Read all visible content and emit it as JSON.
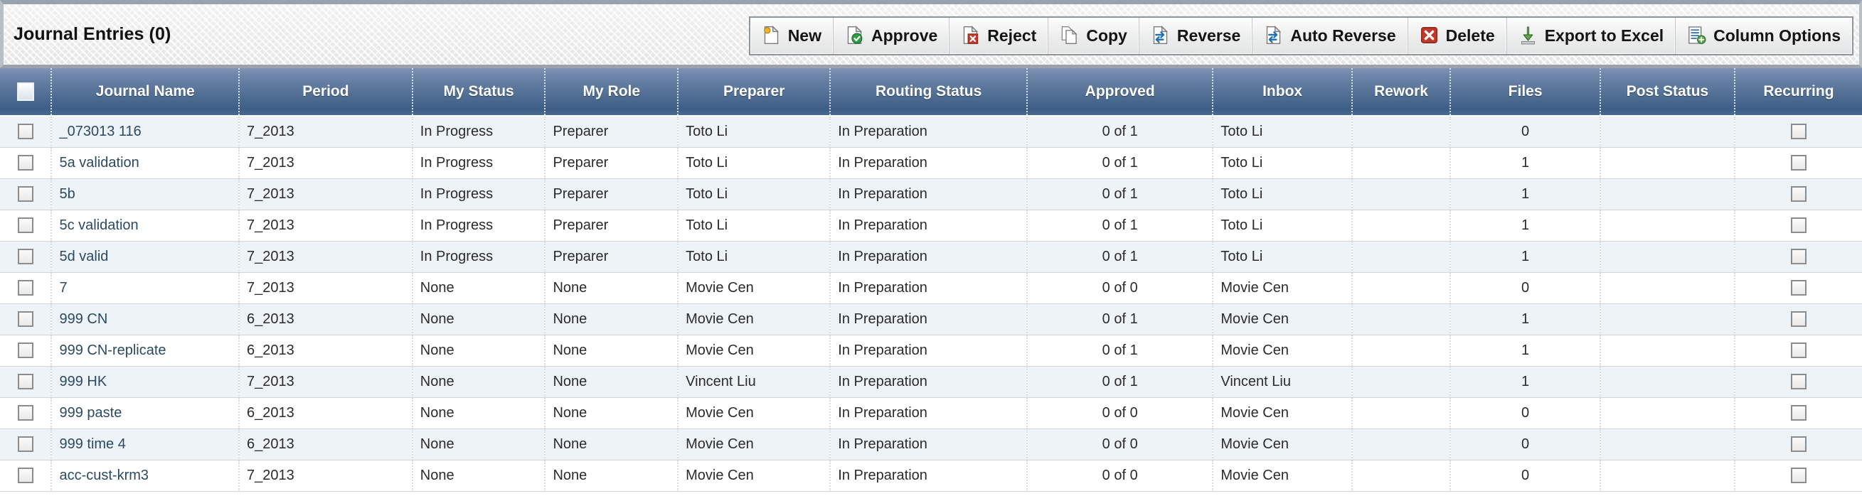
{
  "header": {
    "title": "Journal Entries (0)"
  },
  "toolbar": {
    "buttons": [
      {
        "label": "New",
        "icon": "new-document-icon"
      },
      {
        "label": "Approve",
        "icon": "approve-document-icon"
      },
      {
        "label": "Reject",
        "icon": "reject-document-icon"
      },
      {
        "label": "Copy",
        "icon": "copy-icon"
      },
      {
        "label": "Reverse",
        "icon": "reverse-document-icon"
      },
      {
        "label": "Auto Reverse",
        "icon": "auto-reverse-document-icon"
      },
      {
        "label": "Delete",
        "icon": "delete-icon"
      },
      {
        "label": "Export to Excel",
        "icon": "export-download-icon"
      },
      {
        "label": "Column Options",
        "icon": "column-options-icon"
      }
    ]
  },
  "grid": {
    "columns": [
      {
        "key": "check",
        "label": "",
        "align": "center"
      },
      {
        "key": "journal",
        "label": "Journal Name",
        "align": "left"
      },
      {
        "key": "period",
        "label": "Period",
        "align": "left"
      },
      {
        "key": "mystatus",
        "label": "My Status",
        "align": "left"
      },
      {
        "key": "myrole",
        "label": "My Role",
        "align": "left"
      },
      {
        "key": "preparer",
        "label": "Preparer",
        "align": "left"
      },
      {
        "key": "routing",
        "label": "Routing Status",
        "align": "left"
      },
      {
        "key": "approved",
        "label": "Approved",
        "align": "center"
      },
      {
        "key": "inbox",
        "label": "Inbox",
        "align": "left"
      },
      {
        "key": "rework",
        "label": "Rework",
        "align": "center"
      },
      {
        "key": "files",
        "label": "Files",
        "align": "center"
      },
      {
        "key": "post",
        "label": "Post Status",
        "align": "center"
      },
      {
        "key": "recurring",
        "label": "Recurring",
        "align": "center"
      }
    ],
    "rows": [
      {
        "journal": "_073013 116",
        "period": "7_2013",
        "mystatus": "In Progress",
        "myrole": "Preparer",
        "preparer": "Toto Li",
        "routing": "In Preparation",
        "approved": "0 of 1",
        "inbox": "Toto Li",
        "rework": "",
        "files": "0",
        "post": "",
        "recurring": false
      },
      {
        "journal": "5a validation",
        "period": "7_2013",
        "mystatus": "In Progress",
        "myrole": "Preparer",
        "preparer": "Toto Li",
        "routing": "In Preparation",
        "approved": "0 of 1",
        "inbox": "Toto Li",
        "rework": "",
        "files": "1",
        "post": "",
        "recurring": false
      },
      {
        "journal": "5b",
        "period": "7_2013",
        "mystatus": "In Progress",
        "myrole": "Preparer",
        "preparer": "Toto Li",
        "routing": "In Preparation",
        "approved": "0 of 1",
        "inbox": "Toto Li",
        "rework": "",
        "files": "1",
        "post": "",
        "recurring": false
      },
      {
        "journal": "5c validation",
        "period": "7_2013",
        "mystatus": "In Progress",
        "myrole": "Preparer",
        "preparer": "Toto Li",
        "routing": "In Preparation",
        "approved": "0 of 1",
        "inbox": "Toto Li",
        "rework": "",
        "files": "1",
        "post": "",
        "recurring": false
      },
      {
        "journal": "5d valid",
        "period": "7_2013",
        "mystatus": "In Progress",
        "myrole": "Preparer",
        "preparer": "Toto Li",
        "routing": "In Preparation",
        "approved": "0 of 1",
        "inbox": "Toto Li",
        "rework": "",
        "files": "1",
        "post": "",
        "recurring": false
      },
      {
        "journal": "7",
        "period": "7_2013",
        "mystatus": "None",
        "myrole": "None",
        "preparer": "Movie Cen",
        "routing": "In Preparation",
        "approved": "0 of 0",
        "inbox": "Movie Cen",
        "rework": "",
        "files": "0",
        "post": "",
        "recurring": false
      },
      {
        "journal": "999 CN",
        "period": "6_2013",
        "mystatus": "None",
        "myrole": "None",
        "preparer": "Movie Cen",
        "routing": "In Preparation",
        "approved": "0 of 1",
        "inbox": "Movie Cen",
        "rework": "",
        "files": "1",
        "post": "",
        "recurring": false
      },
      {
        "journal": "999 CN-replicate",
        "period": "6_2013",
        "mystatus": "None",
        "myrole": "None",
        "preparer": "Movie Cen",
        "routing": "In Preparation",
        "approved": "0 of 1",
        "inbox": "Movie Cen",
        "rework": "",
        "files": "1",
        "post": "",
        "recurring": false
      },
      {
        "journal": "999 HK",
        "period": "7_2013",
        "mystatus": "None",
        "myrole": "None",
        "preparer": "Vincent Liu",
        "routing": "In Preparation",
        "approved": "0 of 1",
        "inbox": "Vincent Liu",
        "rework": "",
        "files": "1",
        "post": "",
        "recurring": false
      },
      {
        "journal": "999 paste",
        "period": "6_2013",
        "mystatus": "None",
        "myrole": "None",
        "preparer": "Movie Cen",
        "routing": "In Preparation",
        "approved": "0 of 0",
        "inbox": "Movie Cen",
        "rework": "",
        "files": "0",
        "post": "",
        "recurring": false
      },
      {
        "journal": "999 time 4",
        "period": "6_2013",
        "mystatus": "None",
        "myrole": "None",
        "preparer": "Movie Cen",
        "routing": "In Preparation",
        "approved": "0 of 0",
        "inbox": "Movie Cen",
        "rework": "",
        "files": "0",
        "post": "",
        "recurring": false
      },
      {
        "journal": "acc-cust-krm3",
        "period": "7_2013",
        "mystatus": "None",
        "myrole": "None",
        "preparer": "Movie Cen",
        "routing": "In Preparation",
        "approved": "0 of 0",
        "inbox": "Movie Cen",
        "rework": "",
        "files": "0",
        "post": "",
        "recurring": false
      }
    ]
  },
  "colors": {
    "header_blue_top": "#7d93b3",
    "header_blue_bottom": "#3d5d85",
    "row_alt": "#eef3f8",
    "link": "#2b4a63",
    "chrome_gray": "#9aa3ad"
  }
}
